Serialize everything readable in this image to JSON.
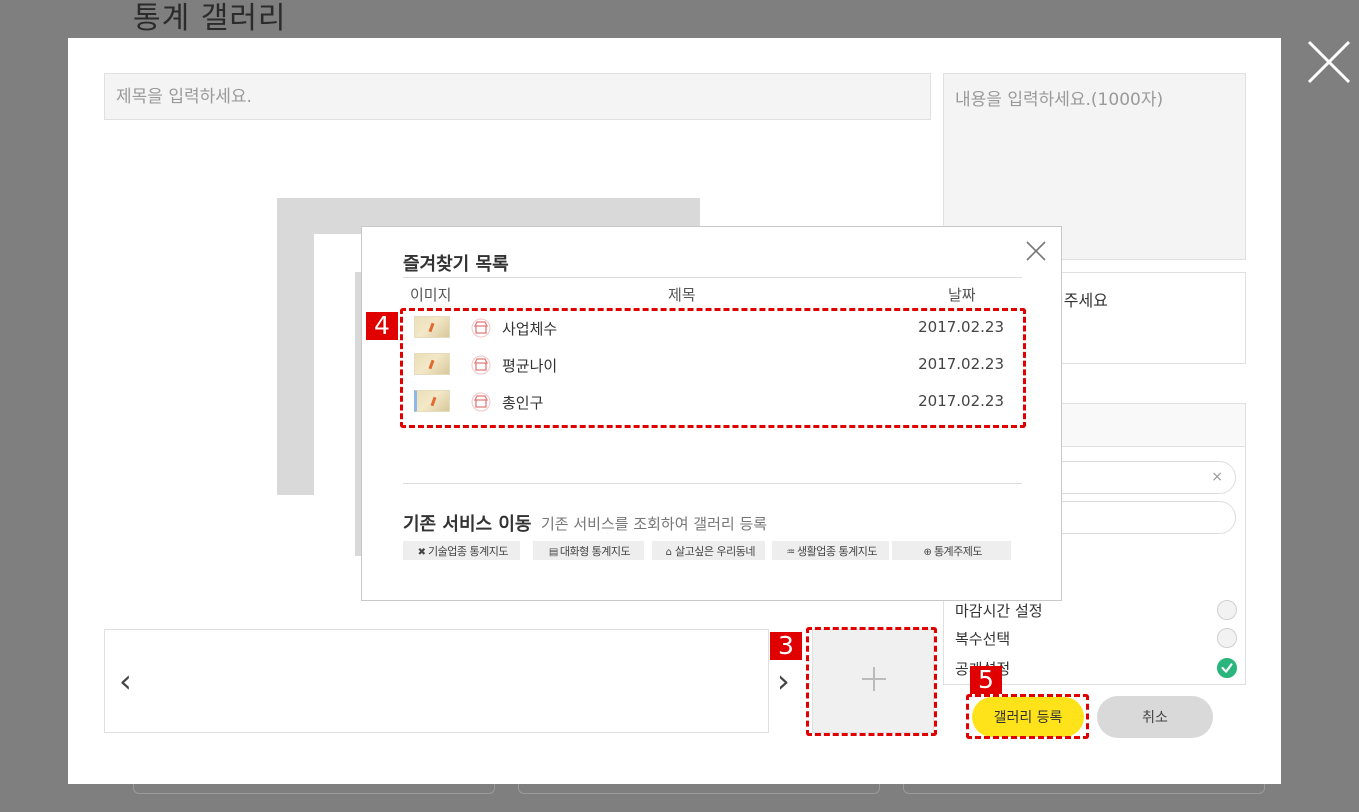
{
  "page_title": "통계 갤러리",
  "form": {
    "title_placeholder": "제목을 입력하세요.",
    "content_placeholder": "내용을 입력하세요.(1000자)",
    "side_hint": "해주세요"
  },
  "options": {
    "deadline_label": "마감시간 설정",
    "multi_select_label": "복수선택",
    "public_label": "공개설정",
    "deadline_on": false,
    "multi_select_on": false,
    "public_on": true,
    "clear_glyph": "×"
  },
  "slider": {
    "prev_glyph": "‹",
    "next_glyph": "›"
  },
  "buttons": {
    "register": "갤러리 등록",
    "cancel": "취소"
  },
  "favorites": {
    "title": "즐겨찾기 목록",
    "columns": [
      "이미지",
      "제목",
      "날짜"
    ],
    "rows": [
      {
        "title": "사업체수",
        "date": "2017.02.23"
      },
      {
        "title": "평균나이",
        "date": "2017.02.23"
      },
      {
        "title": "총인구",
        "date": "2017.02.23"
      }
    ],
    "service_heading": "기존 서비스 이동",
    "service_sub": "기존 서비스를 조회하여 갤러리 등록",
    "services": [
      {
        "label": "기술업종 통계지도",
        "icon": "tools-icon",
        "glyph": "✖"
      },
      {
        "label": "대화형 통계지도",
        "icon": "document-icon",
        "glyph": "▤"
      },
      {
        "label": "살고싶은 우리동네",
        "icon": "house-icon",
        "glyph": "⌂"
      },
      {
        "label": "생활업종 통계지도",
        "icon": "store-icon",
        "glyph": "♒"
      },
      {
        "label": "통계주제도",
        "icon": "map-pin-icon",
        "glyph": "⊕"
      }
    ]
  },
  "annotations": {
    "badge_3": "3",
    "badge_4": "4",
    "badge_5": "5"
  },
  "colors": {
    "accent_yellow": "#ffe31a",
    "toggle_on": "#2ab57d",
    "annotation_red": "#e00000",
    "overlay": "#7f7f7f"
  }
}
